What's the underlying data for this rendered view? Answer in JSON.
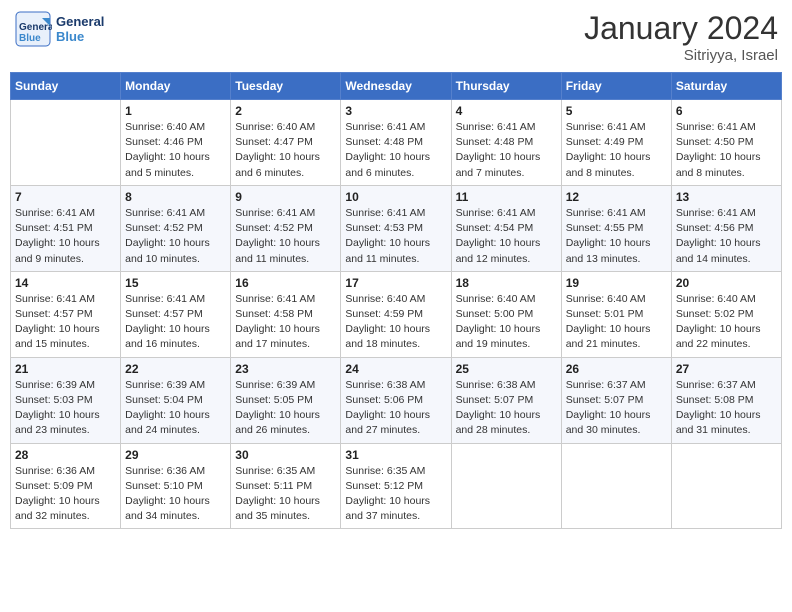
{
  "header": {
    "logo_line1": "General",
    "logo_line2": "Blue",
    "month_title": "January 2024",
    "subtitle": "Sitriyya, Israel"
  },
  "calendar": {
    "days_of_week": [
      "Sunday",
      "Monday",
      "Tuesday",
      "Wednesday",
      "Thursday",
      "Friday",
      "Saturday"
    ],
    "weeks": [
      [
        {
          "day": "",
          "info": ""
        },
        {
          "day": "1",
          "info": "Sunrise: 6:40 AM\nSunset: 4:46 PM\nDaylight: 10 hours\nand 5 minutes."
        },
        {
          "day": "2",
          "info": "Sunrise: 6:40 AM\nSunset: 4:47 PM\nDaylight: 10 hours\nand 6 minutes."
        },
        {
          "day": "3",
          "info": "Sunrise: 6:41 AM\nSunset: 4:48 PM\nDaylight: 10 hours\nand 6 minutes."
        },
        {
          "day": "4",
          "info": "Sunrise: 6:41 AM\nSunset: 4:48 PM\nDaylight: 10 hours\nand 7 minutes."
        },
        {
          "day": "5",
          "info": "Sunrise: 6:41 AM\nSunset: 4:49 PM\nDaylight: 10 hours\nand 8 minutes."
        },
        {
          "day": "6",
          "info": "Sunrise: 6:41 AM\nSunset: 4:50 PM\nDaylight: 10 hours\nand 8 minutes."
        }
      ],
      [
        {
          "day": "7",
          "info": "Sunrise: 6:41 AM\nSunset: 4:51 PM\nDaylight: 10 hours\nand 9 minutes."
        },
        {
          "day": "8",
          "info": "Sunrise: 6:41 AM\nSunset: 4:52 PM\nDaylight: 10 hours\nand 10 minutes."
        },
        {
          "day": "9",
          "info": "Sunrise: 6:41 AM\nSunset: 4:52 PM\nDaylight: 10 hours\nand 11 minutes."
        },
        {
          "day": "10",
          "info": "Sunrise: 6:41 AM\nSunset: 4:53 PM\nDaylight: 10 hours\nand 11 minutes."
        },
        {
          "day": "11",
          "info": "Sunrise: 6:41 AM\nSunset: 4:54 PM\nDaylight: 10 hours\nand 12 minutes."
        },
        {
          "day": "12",
          "info": "Sunrise: 6:41 AM\nSunset: 4:55 PM\nDaylight: 10 hours\nand 13 minutes."
        },
        {
          "day": "13",
          "info": "Sunrise: 6:41 AM\nSunset: 4:56 PM\nDaylight: 10 hours\nand 14 minutes."
        }
      ],
      [
        {
          "day": "14",
          "info": "Sunrise: 6:41 AM\nSunset: 4:57 PM\nDaylight: 10 hours\nand 15 minutes."
        },
        {
          "day": "15",
          "info": "Sunrise: 6:41 AM\nSunset: 4:57 PM\nDaylight: 10 hours\nand 16 minutes."
        },
        {
          "day": "16",
          "info": "Sunrise: 6:41 AM\nSunset: 4:58 PM\nDaylight: 10 hours\nand 17 minutes."
        },
        {
          "day": "17",
          "info": "Sunrise: 6:40 AM\nSunset: 4:59 PM\nDaylight: 10 hours\nand 18 minutes."
        },
        {
          "day": "18",
          "info": "Sunrise: 6:40 AM\nSunset: 5:00 PM\nDaylight: 10 hours\nand 19 minutes."
        },
        {
          "day": "19",
          "info": "Sunrise: 6:40 AM\nSunset: 5:01 PM\nDaylight: 10 hours\nand 21 minutes."
        },
        {
          "day": "20",
          "info": "Sunrise: 6:40 AM\nSunset: 5:02 PM\nDaylight: 10 hours\nand 22 minutes."
        }
      ],
      [
        {
          "day": "21",
          "info": "Sunrise: 6:39 AM\nSunset: 5:03 PM\nDaylight: 10 hours\nand 23 minutes."
        },
        {
          "day": "22",
          "info": "Sunrise: 6:39 AM\nSunset: 5:04 PM\nDaylight: 10 hours\nand 24 minutes."
        },
        {
          "day": "23",
          "info": "Sunrise: 6:39 AM\nSunset: 5:05 PM\nDaylight: 10 hours\nand 26 minutes."
        },
        {
          "day": "24",
          "info": "Sunrise: 6:38 AM\nSunset: 5:06 PM\nDaylight: 10 hours\nand 27 minutes."
        },
        {
          "day": "25",
          "info": "Sunrise: 6:38 AM\nSunset: 5:07 PM\nDaylight: 10 hours\nand 28 minutes."
        },
        {
          "day": "26",
          "info": "Sunrise: 6:37 AM\nSunset: 5:07 PM\nDaylight: 10 hours\nand 30 minutes."
        },
        {
          "day": "27",
          "info": "Sunrise: 6:37 AM\nSunset: 5:08 PM\nDaylight: 10 hours\nand 31 minutes."
        }
      ],
      [
        {
          "day": "28",
          "info": "Sunrise: 6:36 AM\nSunset: 5:09 PM\nDaylight: 10 hours\nand 32 minutes."
        },
        {
          "day": "29",
          "info": "Sunrise: 6:36 AM\nSunset: 5:10 PM\nDaylight: 10 hours\nand 34 minutes."
        },
        {
          "day": "30",
          "info": "Sunrise: 6:35 AM\nSunset: 5:11 PM\nDaylight: 10 hours\nand 35 minutes."
        },
        {
          "day": "31",
          "info": "Sunrise: 6:35 AM\nSunset: 5:12 PM\nDaylight: 10 hours\nand 37 minutes."
        },
        {
          "day": "",
          "info": ""
        },
        {
          "day": "",
          "info": ""
        },
        {
          "day": "",
          "info": ""
        }
      ]
    ]
  }
}
